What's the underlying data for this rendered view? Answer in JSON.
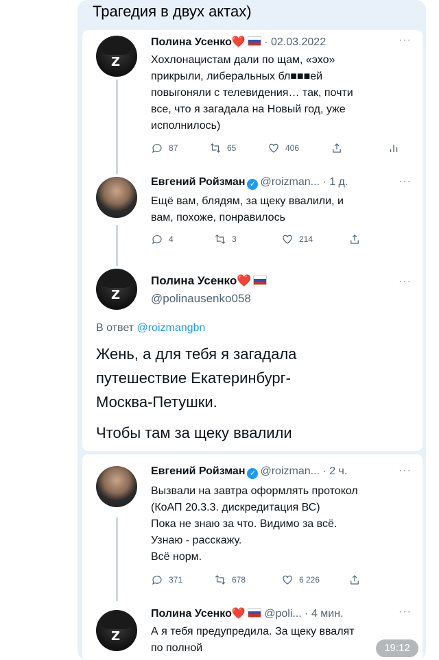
{
  "message": {
    "title": "Трагедия в двух актах)",
    "time": "19:12"
  },
  "tweets": [
    {
      "author": "Полина Усенко",
      "emoji": "❤️",
      "handle_date": "· 02.03.2022",
      "text": "Хохлонацистам дали по щам, «эхо»\nприкрыли, либеральных бл■■■ей\nповыгоняли с телевидения… так, почти\nвсе, что я загадала на Новый год, уже\nисполнилось)",
      "replies": "87",
      "retweets": "65",
      "likes": "406"
    },
    {
      "author": "Евгений Ройзман",
      "handle": "@roizman...",
      "date": "· 1 д.",
      "text": "Ещё вам, блядям, за щеку ввалили, и\nвам, похоже, понравилось",
      "replies": "4",
      "retweets": "3",
      "likes": "214"
    },
    {
      "author": "Полина Усенко",
      "emoji": "❤️",
      "handle": "@polinausenko058",
      "reply_prefix": "В ответ",
      "reply_to": "@roizmangbn",
      "text": "Жень, а для тебя я загадала\nпутешествие Екатеринбург-\nМосква-Петушки.",
      "text2": "Чтобы там за щеку ввалили"
    },
    {
      "author": "Евгений Ройзман",
      "handle": "@roizman...",
      "date": "· 2 ч.",
      "text": "Вызвали на завтра оформлять протокол\n(КоАП 20.3.3. дискредитация ВС)\nПока не знаю за что. Видимо за всё.\nУзнаю - расскажу.\nВсё норм.",
      "replies": "371",
      "retweets": "678",
      "likes": "6 226"
    },
    {
      "author": "Полина Усенко",
      "emoji": "❤️",
      "handle": "@poli...",
      "date": "· 4 мин.",
      "text": "А я тебя предупредила. За щеку ввалят\nпо полной"
    }
  ],
  "more_glyph": "···"
}
